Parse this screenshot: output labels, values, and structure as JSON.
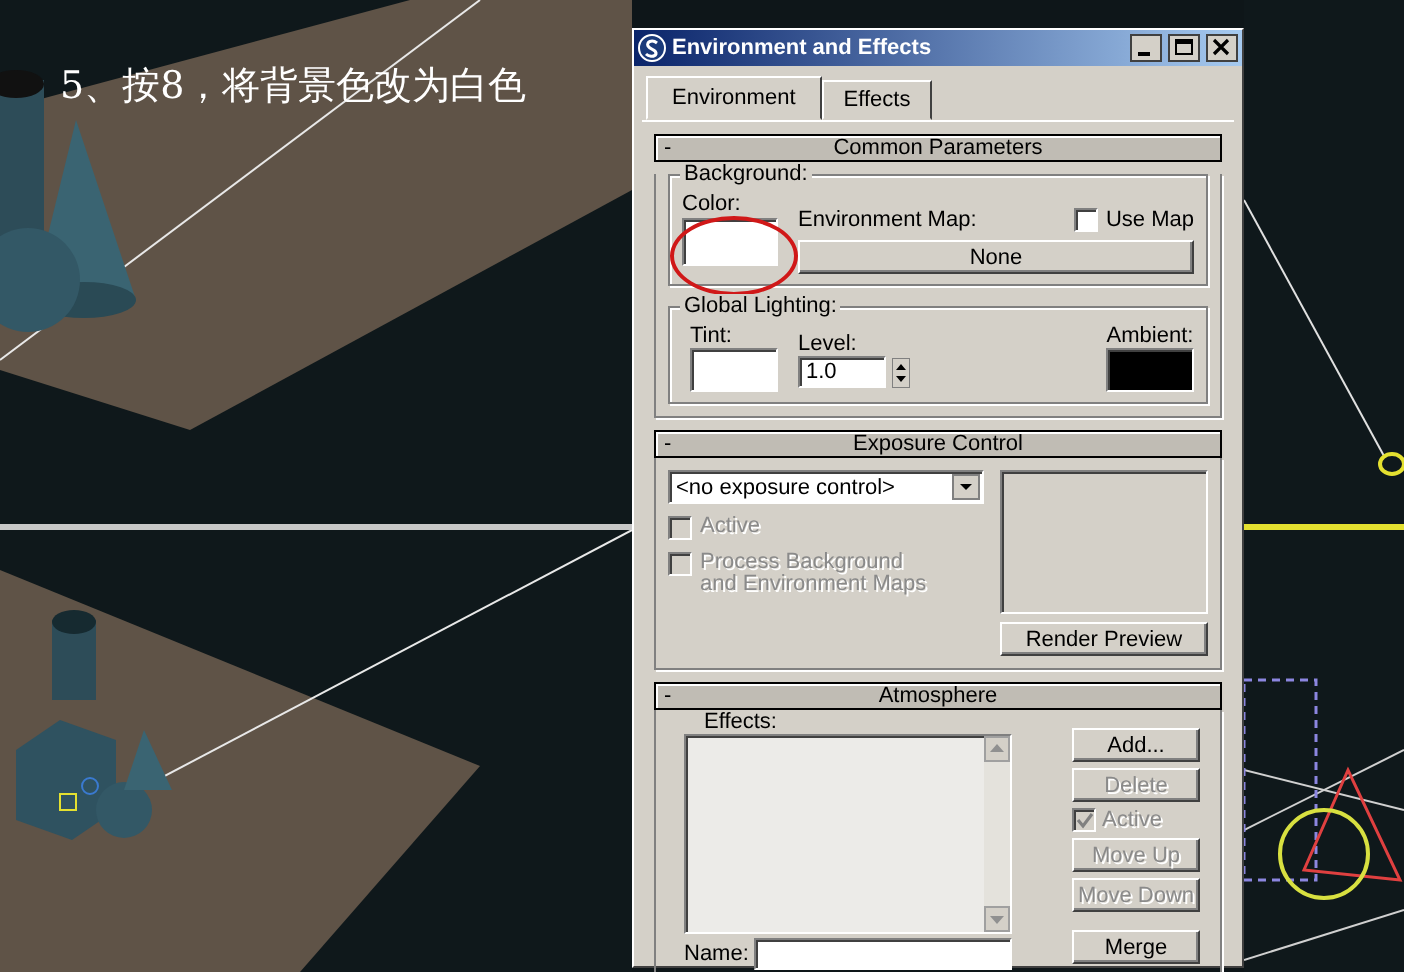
{
  "caption": "5、按8，将背景色改为白色",
  "window": {
    "title": "Environment and Effects"
  },
  "tabs": [
    {
      "label": "Environment",
      "selected": true
    },
    {
      "label": "Effects",
      "selected": false
    }
  ],
  "common_parameters": {
    "toggle": "-",
    "title": "Common Parameters",
    "background": {
      "group": "Background:",
      "color_label": "Color:",
      "circled": true,
      "env_map_label": "Environment Map:",
      "use_map": {
        "label": "Use Map",
        "checked": false
      },
      "map_button": "None"
    },
    "global_lighting": {
      "group": "Global Lighting:",
      "tint_label": "Tint:",
      "level_label": "Level:",
      "level_value": "1.0",
      "ambient_label": "Ambient:"
    }
  },
  "exposure_control": {
    "toggle": "-",
    "title": "Exposure Control",
    "dropdown": "<no exposure control>",
    "options": [
      {
        "label": "Active",
        "checked": false,
        "disabled": true
      },
      {
        "label": "Process Background\nand Environment Maps",
        "checked": false,
        "disabled": true
      }
    ],
    "render_preview": {
      "label": "Render Preview",
      "disabled": false
    }
  },
  "atmosphere": {
    "toggle": "-",
    "title": "Atmosphere",
    "effects_label": "Effects:",
    "controls": [
      {
        "kind": "button",
        "label": "Add...",
        "disabled": false
      },
      {
        "kind": "button",
        "label": "Delete",
        "disabled": true
      },
      {
        "kind": "checkbox",
        "label": "Active",
        "checked": true,
        "disabled": true
      },
      {
        "kind": "button",
        "label": "Move Up",
        "disabled": true
      },
      {
        "kind": "button",
        "label": "Move Down",
        "disabled": true
      },
      {
        "kind": "button",
        "label": "Merge",
        "disabled": false
      }
    ],
    "name_label": "Name:"
  }
}
